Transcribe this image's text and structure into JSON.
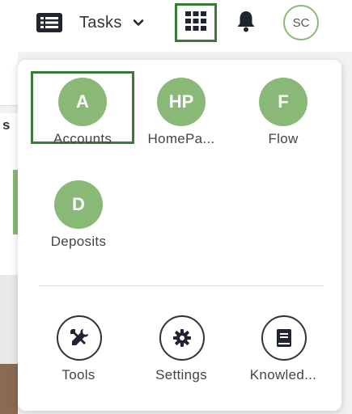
{
  "topbar": {
    "tasks_label": "Tasks",
    "tasks_icon": "list-icon",
    "chevron_icon": "chevron-down-icon",
    "apps_icon": "grid-icon",
    "bell_icon": "bell-icon",
    "avatar_initials": "SC"
  },
  "apps_menu": {
    "accent_color": "#8ab877",
    "selected_border_color": "#3c7a3a",
    "apps": [
      {
        "initials": "A",
        "label": "Accounts",
        "selected": true
      },
      {
        "initials": "HP",
        "label": "HomePa..."
      },
      {
        "initials": "F",
        "label": "Flow"
      },
      {
        "initials": "D",
        "label": "Deposits"
      }
    ],
    "tools": [
      {
        "icon": "tools-icon",
        "label": "Tools"
      },
      {
        "icon": "gear-icon",
        "label": "Settings"
      },
      {
        "icon": "book-icon",
        "label": "Knowled..."
      }
    ]
  },
  "background": {
    "partial_glyph": "s"
  }
}
